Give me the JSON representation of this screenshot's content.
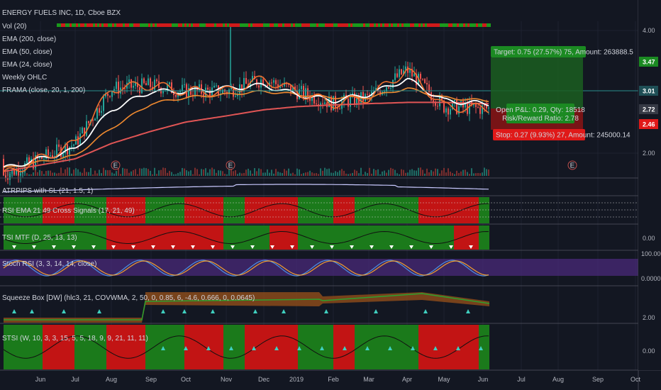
{
  "header": {
    "title": "ENERGY FUELS INC, 1D, Cboe BZX"
  },
  "legend": [
    "Vol (20)",
    "EMA (200, close)",
    "EMA (50, close)",
    "EMA (24, close)",
    "Weekly OHLC",
    "FRAMA (close, 20, 1, 200)"
  ],
  "indicators": [
    "ATRPIPS with SL (21, 1.5, 1)",
    "RSI EMA 21 49 Cross Signals (17, 21, 49)",
    "TSI MTF (D, 25, 13, 13)",
    "Stoch RSI (3, 3, 14, 14, close)",
    "Squeeze Box [DW] (hlc3, 21, COVWMA, 2, 50, 0, 0.85, 6, -4.6, 0.666, 0, 0.0645)",
    "STSI (W, 10, 3, 3, 15, 5, 5, 18, 9, 9, 21, 11, 11)"
  ],
  "trade": {
    "target": "Target: 0.75 (27.57%) 75, Amount: 263888.5",
    "open_pl": "Open P&L: 0.29, Qty: 18518",
    "risk_reward": "Risk/Reward Ratio: 2.78",
    "stop": "Stop: 0.27 (9.93%) 27, Amount: 245000.14"
  },
  "price_axis": {
    "ticks": [
      "4.00",
      "3.00",
      "2.00"
    ],
    "badges": [
      {
        "label": "3.47",
        "color": "#1b8a22"
      },
      {
        "label": "3.01",
        "color": "#1f4f56"
      },
      {
        "label": "2.72",
        "color": "#363a45"
      },
      {
        "label": "2.46",
        "color": "#e01919"
      }
    ]
  },
  "sub_axes": [
    {
      "label": "0.00"
    },
    {
      "label": "100.0000"
    },
    {
      "label": "0.0000"
    },
    {
      "label": "2.00"
    },
    {
      "label": "0.00"
    }
  ],
  "x_axis": [
    "Jun",
    "Jul",
    "Aug",
    "Sep",
    "Oct",
    "Nov",
    "Dec",
    "2019",
    "Feb",
    "Mar",
    "Apr",
    "May",
    "Jun",
    "Jul",
    "Aug",
    "Sep",
    "Oct"
  ],
  "earnings_marker": "E",
  "colors": {
    "background": "#131722",
    "up": "#26a69a",
    "down": "#ef5350",
    "ema200": "#e05555",
    "ema50": "#f08a30",
    "ema24": "#ffffff",
    "frama": "#f07030",
    "green_zone": "#1b7a1b",
    "red_zone": "#c21414"
  },
  "chart_data": {
    "type": "candlestick",
    "title": "ENERGY FUELS INC, 1D, Cboe BZX",
    "x": [
      "Jun",
      "Jul",
      "Aug",
      "Sep",
      "Oct",
      "Nov",
      "Dec",
      "2019",
      "Feb",
      "Mar",
      "Apr",
      "May",
      "Jun"
    ],
    "close": [
      1.9,
      2.15,
      3.05,
      3.1,
      3.0,
      3.0,
      3.2,
      3.0,
      2.8,
      2.9,
      3.35,
      2.75,
      2.72
    ],
    "ema200": [
      1.8,
      1.9,
      2.15,
      2.35,
      2.5,
      2.6,
      2.7,
      2.75,
      2.78,
      2.8,
      2.82,
      2.82,
      2.8
    ],
    "ema50": [
      1.85,
      1.95,
      2.4,
      2.8,
      2.9,
      2.95,
      3.0,
      2.95,
      2.9,
      2.9,
      3.05,
      2.9,
      2.85
    ],
    "ema24": [
      1.9,
      2.05,
      2.7,
      3.0,
      3.0,
      3.05,
      3.1,
      2.95,
      2.85,
      2.95,
      3.2,
      2.85,
      2.8
    ],
    "ylim": [
      1.75,
      4.1
    ],
    "position": {
      "entry": 2.72,
      "target": 3.47,
      "stop": 2.46,
      "current": 3.01
    }
  }
}
